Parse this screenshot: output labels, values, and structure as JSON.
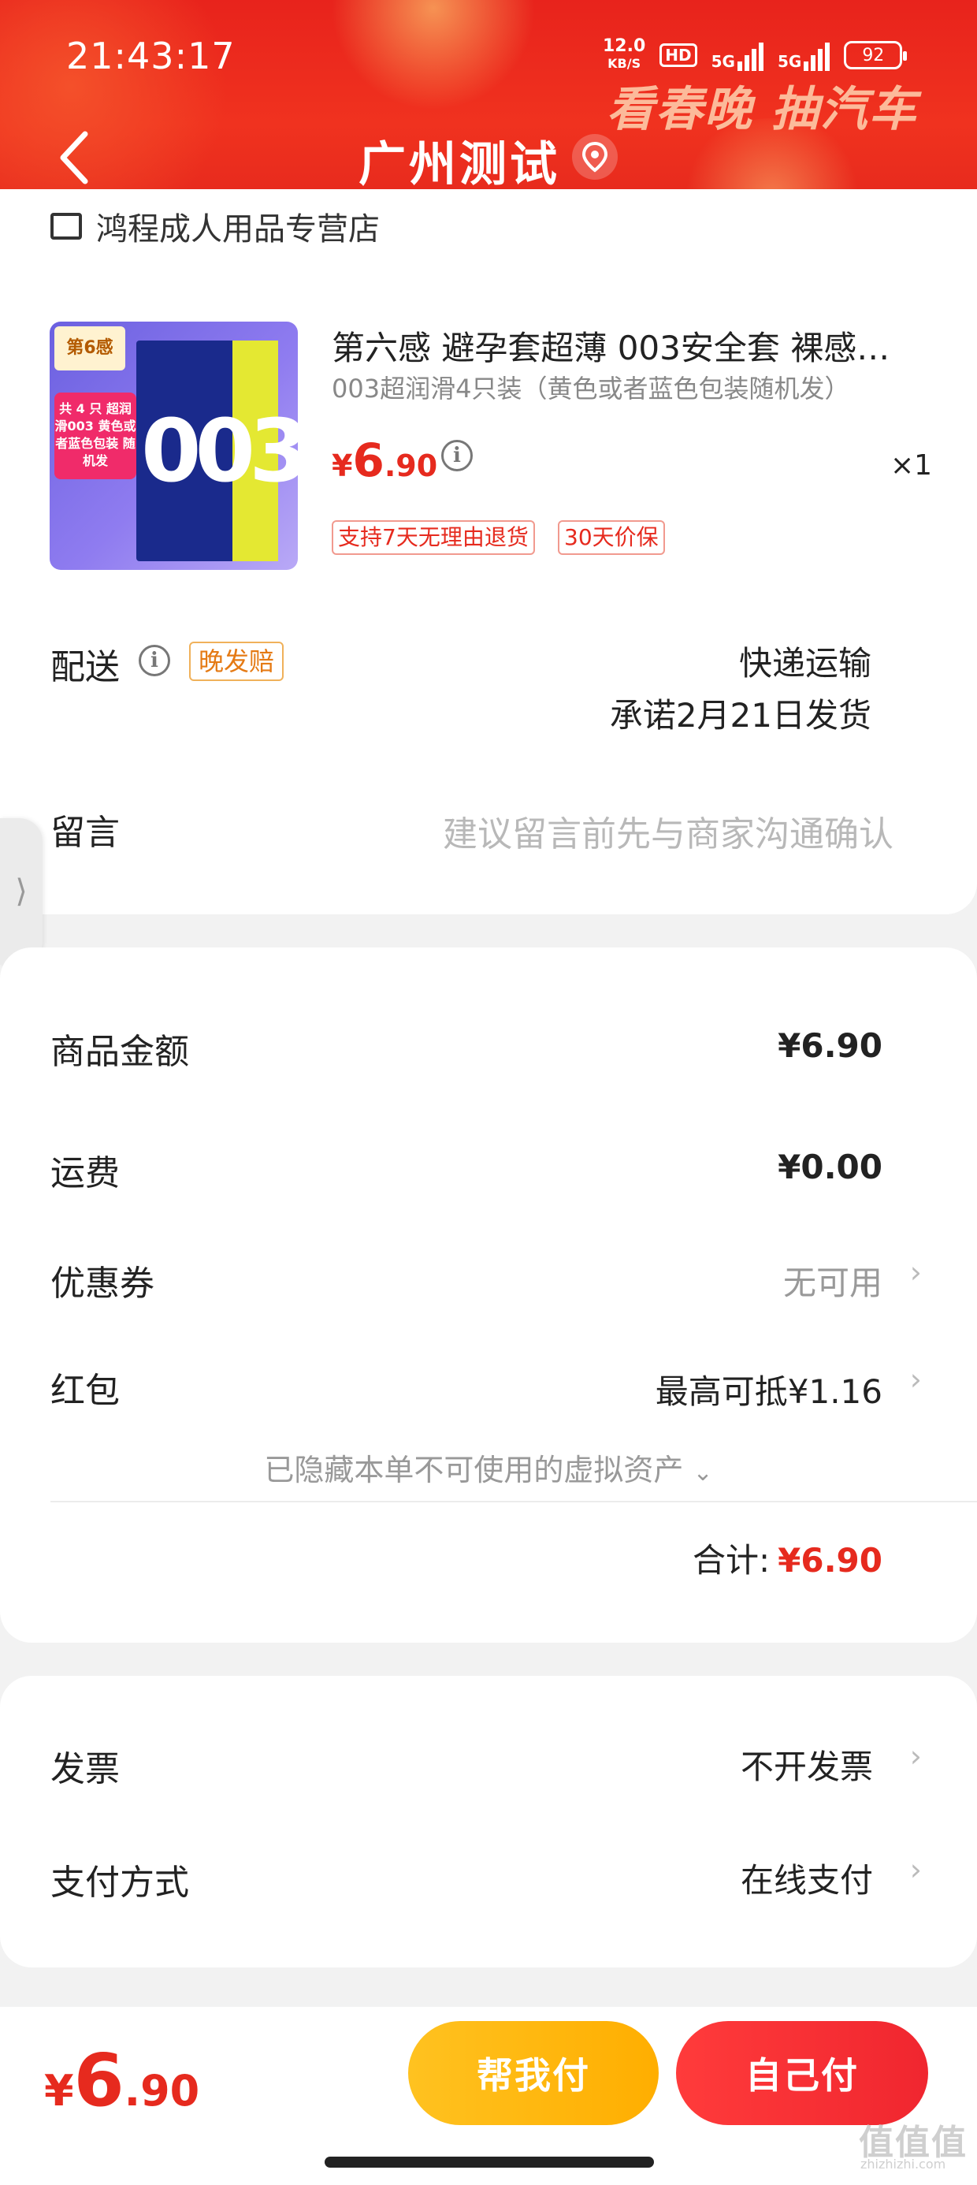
{
  "status_bar": {
    "time": "21:43:17",
    "net_speed_value": "12.0",
    "net_speed_unit": "KB/S",
    "hd_badge": "HD",
    "signal1_label": "5G",
    "signal2_label": "5G",
    "battery": "92"
  },
  "header": {
    "promo_text": "看春晚 抽汽车",
    "title": "广州测试"
  },
  "store": {
    "name": "鸿程成人用品专营店"
  },
  "product": {
    "image_brand": "第6感",
    "image_tag": "共 4 只 超润滑003 黄色或者蓝色包装 随机发",
    "image_number": "003",
    "title": "第六感 避孕套超薄  003安全套 裸感…",
    "spec": "003超润滑4只装（黄色或者蓝色包装随机发）",
    "price_currency": "¥",
    "price_int": "6",
    "price_dec": ".90",
    "quantity": "×1",
    "tags": [
      "支持7天无理由退货",
      "30天价保"
    ]
  },
  "delivery": {
    "label": "配送",
    "badge": "晚发赔",
    "method": "快递运输",
    "promise": "承诺2月21日发货"
  },
  "message": {
    "label": "留言",
    "placeholder": "建议留言前先与商家沟通确认"
  },
  "side_handle": "⟩",
  "price_summary": {
    "goods_label": "商品金额",
    "goods_value": "¥6.90",
    "shipping_label": "运费",
    "shipping_value": "¥0.00",
    "coupon_label": "优惠券",
    "coupon_value": "无可用",
    "redpacket_label": "红包",
    "redpacket_value": "最高可抵¥1.16",
    "hidden_note": "已隐藏本单不可使用的虚拟资产",
    "total_label": "合计:",
    "total_value": "¥6.90"
  },
  "invoice": {
    "invoice_label": "发票",
    "invoice_value": "不开发票",
    "payment_label": "支付方式",
    "payment_value": "在线支付"
  },
  "bottom_bar": {
    "price_currency": "¥",
    "price_int": "6",
    "price_dec": ".90",
    "help_pay_label": "帮我付",
    "self_pay_label": "自己付",
    "watermark": "值值值",
    "watermark_sub": "zhizhizhi.com"
  },
  "colors": {
    "brand_red": "#e62a1e",
    "help_pay": "#ffb612",
    "self_pay": "#f0262f"
  },
  "icons": [
    "back-chevron-icon",
    "location-pin-icon",
    "store-icon",
    "info-icon",
    "chevron-right-icon",
    "chevron-down-icon"
  ]
}
